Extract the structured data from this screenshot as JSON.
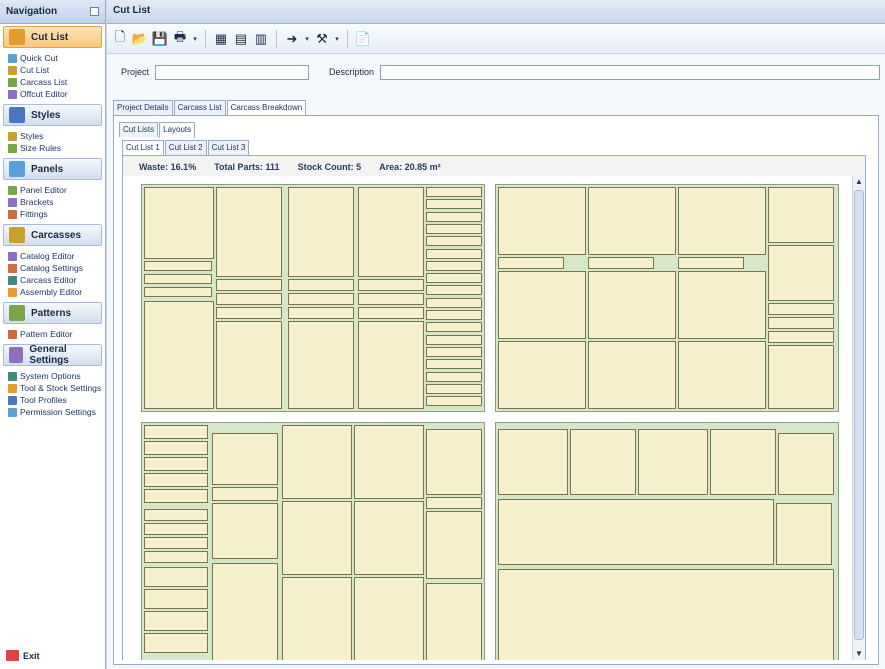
{
  "nav": {
    "title": "Navigation",
    "groups": [
      {
        "label": "Cut List",
        "icon": "cutlist-icon",
        "active": true,
        "items": [
          {
            "label": "Quick Cut",
            "icon": "quickcut-icon"
          },
          {
            "label": "Cut List",
            "icon": "cutlist-doc-icon"
          },
          {
            "label": "Carcass List",
            "icon": "carcass-list-icon"
          },
          {
            "label": "Offcut Editor",
            "icon": "offcut-icon"
          }
        ]
      },
      {
        "label": "Styles",
        "icon": "styles-icon",
        "items": [
          {
            "label": "Styles",
            "icon": "style-icon"
          },
          {
            "label": "Size Rules",
            "icon": "size-rules-icon"
          }
        ]
      },
      {
        "label": "Panels",
        "icon": "panels-icon",
        "items": [
          {
            "label": "Panel Editor",
            "icon": "panel-editor-icon"
          },
          {
            "label": "Brackets",
            "icon": "brackets-icon"
          },
          {
            "label": "Fittings",
            "icon": "fittings-icon"
          }
        ]
      },
      {
        "label": "Carcasses",
        "icon": "carcasses-icon",
        "items": [
          {
            "label": "Catalog Editor",
            "icon": "catalog-editor-icon"
          },
          {
            "label": "Catalog Settings",
            "icon": "catalog-settings-icon"
          },
          {
            "label": "Carcass Editor",
            "icon": "carcass-editor-icon"
          },
          {
            "label": "Assembly Editor",
            "icon": "assembly-editor-icon"
          }
        ]
      },
      {
        "label": "Patterns",
        "icon": "patterns-icon",
        "items": [
          {
            "label": "Pattern Editor",
            "icon": "pattern-editor-icon"
          }
        ]
      },
      {
        "label": "General Settings",
        "icon": "settings-icon",
        "items": [
          {
            "label": "System Options",
            "icon": "system-options-icon"
          },
          {
            "label": "Tool & Stock Settings",
            "icon": "tool-stock-icon"
          },
          {
            "label": "Tool Profiles",
            "icon": "tool-profiles-icon"
          },
          {
            "label": "Permission Settings",
            "icon": "permission-icon"
          }
        ]
      }
    ],
    "exit_label": "Exit"
  },
  "main": {
    "title": "Cut List",
    "toolbar": [
      "new-icon",
      "open-icon",
      "save-icon",
      "print-icon",
      "dropdown-icon",
      "grid-icon",
      "delete-grid-icon",
      "cut-grid-icon",
      "export-icon",
      "dropdown-icon",
      "tools-icon",
      "dropdown-icon",
      "report-icon"
    ],
    "project_label": "Project",
    "project_value": "",
    "description_label": "Description",
    "description_value": "",
    "tabs": [
      "Project Details",
      "Carcass List",
      "Carcass Breakdown"
    ],
    "subtabs": [
      "Cut Lists",
      "Layouts"
    ],
    "cutlist_tabs": [
      "Cut List 1",
      "Cut List 2",
      "Cut List 3"
    ],
    "stats": {
      "waste": "Waste: 16.1%",
      "total_parts": "Total Parts: 111",
      "stock_count": "Stock Count: 5",
      "area": "Area: 20.85 m²"
    }
  },
  "colors": {
    "panel": "#f7f0cf",
    "sheet": "#d6e6c8",
    "accent": "#f8c97b"
  }
}
